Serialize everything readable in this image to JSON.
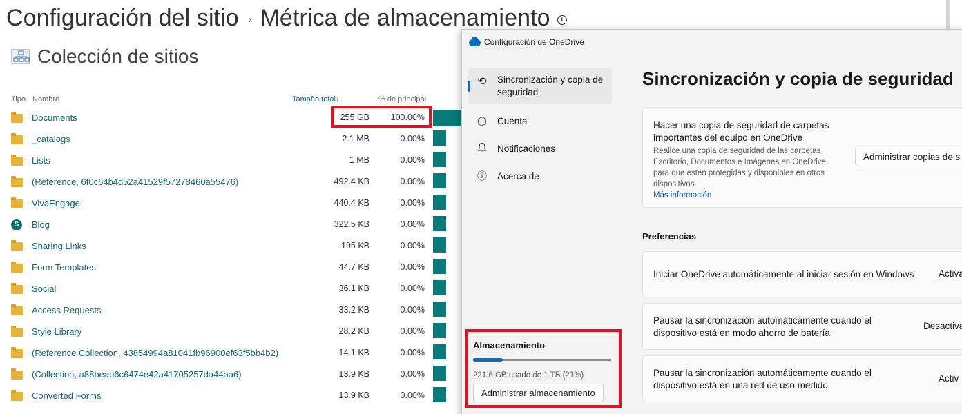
{
  "sharepoint": {
    "title": "Configuración del sitio",
    "separator": "›",
    "subtitle": "Métrica de almacenamiento",
    "info_glyph": "i",
    "section_title": "Colección de sitios",
    "columns": {
      "type": "Tipo",
      "name": "Nombre",
      "size": "Tamaño total↓",
      "percent": "% de principal"
    },
    "rows": [
      {
        "icon": "folder-icon",
        "name": "Documents",
        "size": "255 GB",
        "percent": "100.00%"
      },
      {
        "icon": "folder-icon",
        "name": "_catalogs",
        "size": "2.1 MB",
        "percent": "0.00%"
      },
      {
        "icon": "folder-icon",
        "name": "Lists",
        "size": "1 MB",
        "percent": "0.00%"
      },
      {
        "icon": "folder-icon",
        "name": "(Reference, 6f0c64b4d52a41529f57278460a55476)",
        "size": "492.4 KB",
        "percent": "0.00%"
      },
      {
        "icon": "folder-icon",
        "name": "VivaEngage",
        "size": "440.4 KB",
        "percent": "0.00%"
      },
      {
        "icon": "sharepoint-icon",
        "name": "Blog",
        "size": "322.5 KB",
        "percent": "0.00%"
      },
      {
        "icon": "folder-icon",
        "name": "Sharing Links",
        "size": "195 KB",
        "percent": "0.00%"
      },
      {
        "icon": "folder-icon",
        "name": "Form Templates",
        "size": "44.7 KB",
        "percent": "0.00%"
      },
      {
        "icon": "folder-icon",
        "name": "Social",
        "size": "36.1 KB",
        "percent": "0.00%"
      },
      {
        "icon": "folder-icon",
        "name": "Access Requests",
        "size": "33.2 KB",
        "percent": "0.00%"
      },
      {
        "icon": "folder-icon",
        "name": "Style Library",
        "size": "28.2 KB",
        "percent": "0.00%"
      },
      {
        "icon": "folder-icon",
        "name": "(Reference Collection, 43854994a81041fb96900ef63f5bb4b2)",
        "size": "14.1 KB",
        "percent": "0.00%"
      },
      {
        "icon": "folder-icon",
        "name": "(Collection, a88beab6c6474e42a41705257da44aa6)",
        "size": "13.9 KB",
        "percent": "0.00%"
      },
      {
        "icon": "folder-icon",
        "name": "Converted Forms",
        "size": "13.9 KB",
        "percent": "0.00%"
      }
    ],
    "bar_color": "#087a7a",
    "highlight_color": "#e0141e"
  },
  "onedrive": {
    "window_title": "Configuración de OneDrive",
    "nav": [
      {
        "icon": "sync-icon",
        "glyph": "⟲",
        "label": "Sincronización y copia de seguridad",
        "active": true
      },
      {
        "icon": "person-icon",
        "glyph": "◯",
        "label": "Cuenta",
        "active": false
      },
      {
        "icon": "bell-icon",
        "glyph": "♫",
        "label": "Notificaciones",
        "active": false
      },
      {
        "icon": "info-icon",
        "glyph": "ⓘ",
        "label": "Acerca de",
        "active": false
      }
    ],
    "page_title": "Sincronización y copia de seguridad",
    "backup_card": {
      "title": "Hacer una copia de seguridad de carpetas importantes del equipo en OneDrive",
      "description": "Realice una copia de seguridad de las carpetas Escritorio, Documentos e Imágenes en OneDrive, para que estén protegidas y disponibles en otros dispositivos.",
      "link": "Más información",
      "button": "Administrar copias de s"
    },
    "preferences_label": "Preferencias",
    "preferences": [
      {
        "text": "Iniciar OneDrive automáticamente al iniciar sesión en Windows",
        "state": "Activa"
      },
      {
        "text": "Pausar la sincronización automáticamente cuando el dispositivo está en modo ahorro de batería",
        "state": "Desactiva"
      },
      {
        "text": "Pausar la sincronización automáticamente cuando el dispositivo está en una red de uso medido",
        "state": "Activ"
      }
    ],
    "storage": {
      "title": "Almacenamiento",
      "used_text": "221.6 GB usado de 1 TB (21%)",
      "used_fraction": 0.216,
      "button": "Administrar almacenamiento"
    },
    "accent_color": "#0f6cbd"
  }
}
